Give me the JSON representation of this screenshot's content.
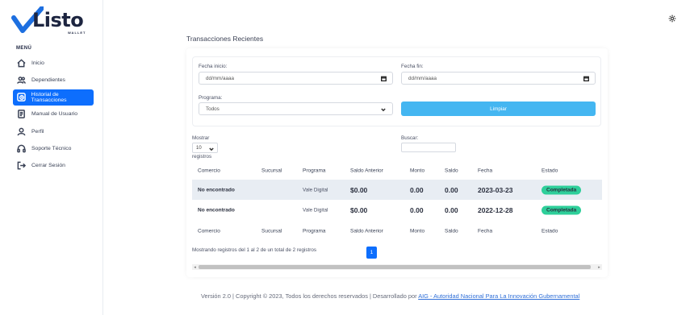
{
  "sidebar": {
    "logo_text": "Listo",
    "logo_sub": "WALLET",
    "menu_title": "MENÚ",
    "items": [
      {
        "label": "Inicio",
        "icon": "home-icon"
      },
      {
        "label": "Dependientes",
        "icon": "users-icon"
      },
      {
        "label": "Historial de Transacciones",
        "icon": "history-icon",
        "active": true
      },
      {
        "label": "Manual de Usuario",
        "icon": "manual-icon"
      },
      {
        "label": "Perfil",
        "icon": "profile-icon"
      },
      {
        "label": "Soporte Técnico",
        "icon": "headset-icon"
      },
      {
        "label": "Cerrar Sesión",
        "icon": "logout-icon"
      }
    ]
  },
  "colors": {
    "primary": "#0d6efd",
    "clear_button": "#44b6f1",
    "badge_success": "#2ecf9a",
    "row_shade": "#e8edf3"
  },
  "main": {
    "title": "Transacciones Recientes",
    "filters": {
      "start_label": "Fecha inicio:",
      "start_placeholder": "dd/mm/aaaa",
      "end_label": "Fecha fin:",
      "end_placeholder": "dd/mm/aaaa",
      "program_label": "Programa:",
      "program_value": "Todos",
      "clear_label": "Limpiar"
    },
    "table_controls": {
      "show_label": "Mostrar",
      "page_size": "10",
      "records_label": "registros",
      "search_label": "Buscar:"
    },
    "table": {
      "columns": [
        "Comercio",
        "Sucursal",
        "Programa",
        "Saldo Anterior",
        "Monto",
        "Saldo",
        "Fecha",
        "Estado"
      ],
      "rows": [
        {
          "comercio": "No encontrado",
          "sucursal": "",
          "programa": "Vale Digital",
          "saldo_anterior": "$0.00",
          "monto": "0.00",
          "saldo": "0.00",
          "fecha": "2023-03-23",
          "estado": "Completada"
        },
        {
          "comercio": "No encontrado",
          "sucursal": "",
          "programa": "Vale Digital",
          "saldo_anterior": "$0.00",
          "monto": "0.00",
          "saldo": "0.00",
          "fecha": "2022-12-28",
          "estado": "Completada"
        }
      ]
    },
    "info_text": "Mostrando registros del 1 al 2 de un total de 2 registros",
    "current_page": "1"
  },
  "footer": {
    "text": "Versión 2.0 | Copyright © 2023, Todos los derechos reservados | Desarrollado por ",
    "link_text": "AIG - Autoridad Nacional Para La Innovación Gubernamental"
  }
}
